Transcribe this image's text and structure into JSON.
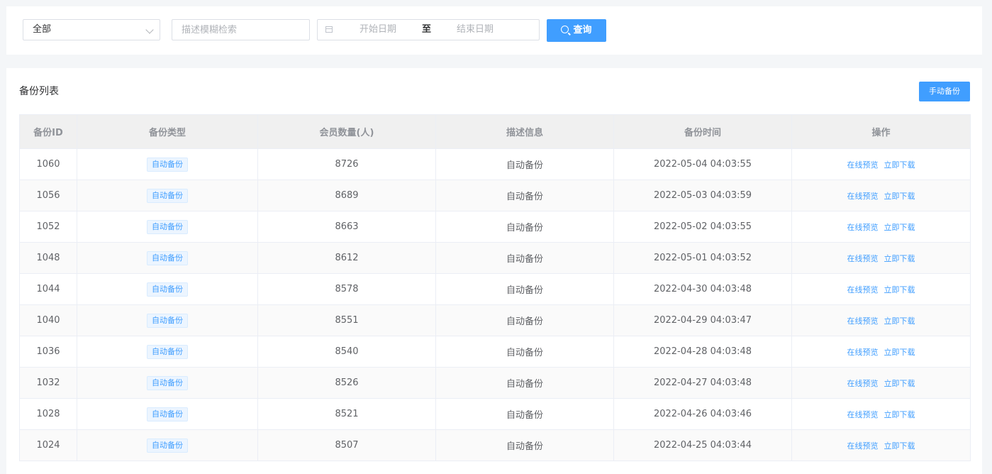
{
  "filters": {
    "type_select": "全部",
    "search_placeholder": "描述模糊检索",
    "start_date_placeholder": "开始日期",
    "range_separator": "至",
    "end_date_placeholder": "结束日期",
    "query_label": "查询"
  },
  "list": {
    "title": "备份列表",
    "manual_backup_label": "手动备份",
    "columns": [
      "备份ID",
      "备份类型",
      "会员数量(人)",
      "描述信息",
      "备份时间",
      "操作"
    ],
    "rows": [
      {
        "id": "1060",
        "type": "自动备份",
        "count": "8726",
        "desc": "自动备份",
        "time": "2022-05-04 04:03:55",
        "preview": "在线预览",
        "download": "立即下载"
      },
      {
        "id": "1056",
        "type": "自动备份",
        "count": "8689",
        "desc": "自动备份",
        "time": "2022-05-03 04:03:59",
        "preview": "在线预览",
        "download": "立即下载"
      },
      {
        "id": "1052",
        "type": "自动备份",
        "count": "8663",
        "desc": "自动备份",
        "time": "2022-05-02 04:03:55",
        "preview": "在线预览",
        "download": "立即下载"
      },
      {
        "id": "1048",
        "type": "自动备份",
        "count": "8612",
        "desc": "自动备份",
        "time": "2022-05-01 04:03:52",
        "preview": "在线预览",
        "download": "立即下载"
      },
      {
        "id": "1044",
        "type": "自动备份",
        "count": "8578",
        "desc": "自动备份",
        "time": "2022-04-30 04:03:48",
        "preview": "在线预览",
        "download": "立即下载"
      },
      {
        "id": "1040",
        "type": "自动备份",
        "count": "8551",
        "desc": "自动备份",
        "time": "2022-04-29 04:03:47",
        "preview": "在线预览",
        "download": "立即下载"
      },
      {
        "id": "1036",
        "type": "自动备份",
        "count": "8540",
        "desc": "自动备份",
        "time": "2022-04-28 04:03:48",
        "preview": "在线预览",
        "download": "立即下载"
      },
      {
        "id": "1032",
        "type": "自动备份",
        "count": "8526",
        "desc": "自动备份",
        "time": "2022-04-27 04:03:48",
        "preview": "在线预览",
        "download": "立即下载"
      },
      {
        "id": "1028",
        "type": "自动备份",
        "count": "8521",
        "desc": "自动备份",
        "time": "2022-04-26 04:03:46",
        "preview": "在线预览",
        "download": "立即下载"
      },
      {
        "id": "1024",
        "type": "自动备份",
        "count": "8507",
        "desc": "自动备份",
        "time": "2022-04-25 04:03:44",
        "preview": "在线预览",
        "download": "立即下载"
      }
    ]
  },
  "colors": {
    "accent": "#409eff",
    "page_bg": "#f4f6f8",
    "header_bg": "#f0f0f0"
  },
  "icons": {
    "select_arrow": "chevron-down-icon",
    "date": "calendar-icon",
    "query": "search-icon"
  }
}
